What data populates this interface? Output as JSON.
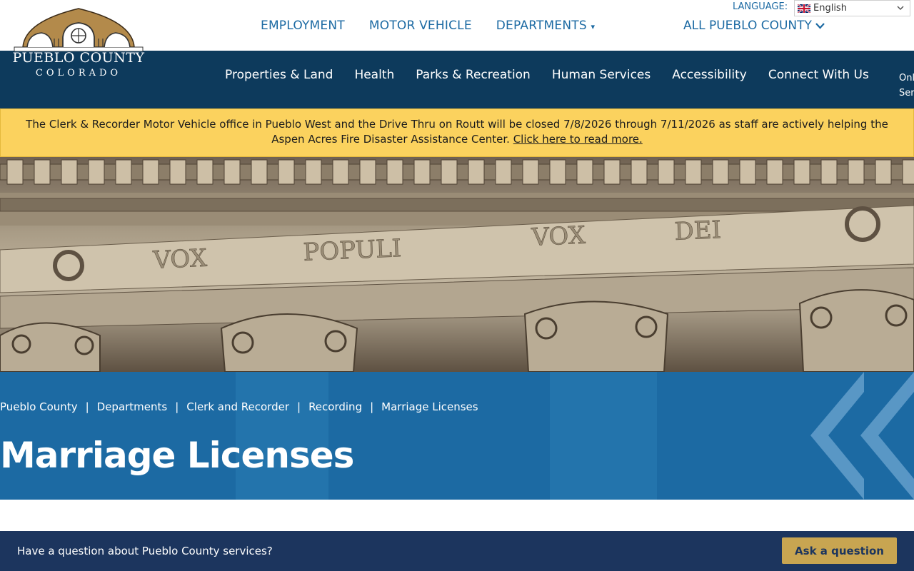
{
  "logo": {
    "name": "PUEBLO COUNTY",
    "state": "COLORADO"
  },
  "util_nav": {
    "employment": "EMPLOYMENT",
    "motor_vehicle": "MOTOR VEHICLE",
    "departments": "DEPARTMENTS",
    "all_county": "ALL PUEBLO COUNTY"
  },
  "language": {
    "label": "LANGUAGE:",
    "selected": "English"
  },
  "main_nav": {
    "items": [
      {
        "label": "Properties & Land"
      },
      {
        "label": "Health"
      },
      {
        "label": "Parks & Recreation"
      },
      {
        "label": "Human Services"
      },
      {
        "label": "Accessibility"
      },
      {
        "label": "Connect With Us"
      }
    ],
    "extra_line1": "Onl",
    "extra_line2": "Ser"
  },
  "alert": {
    "text": "The Clerk & Recorder Motor Vehicle office in Pueblo West and the Drive Thru on Routt will be closed 7/8/2026 through 7/11/2026 as staff are actively helping the Aspen Acres Fire Disaster Assistance Center.",
    "link": "Click here to read more."
  },
  "hero": {
    "inscription_left": "VOX",
    "inscription_mid": "POPULI",
    "inscription_right1": "VOX",
    "inscription_right2": "DEI"
  },
  "breadcrumb": {
    "items": [
      "Pueblo County",
      "Departments",
      "Clerk and Recorder",
      "Recording",
      "Marriage Licenses"
    ],
    "separator": "|"
  },
  "page_title": "Marriage Licenses",
  "ask": {
    "prompt": "Have a question about Pueblo County services?",
    "button": "Ask a question"
  },
  "colors": {
    "nav_dark": "#0d3a5c",
    "brand_blue": "#1c6aa3",
    "alert_yellow": "#fbd25e",
    "ask_bar": "#1c355e",
    "ask_button": "#c8a551"
  }
}
